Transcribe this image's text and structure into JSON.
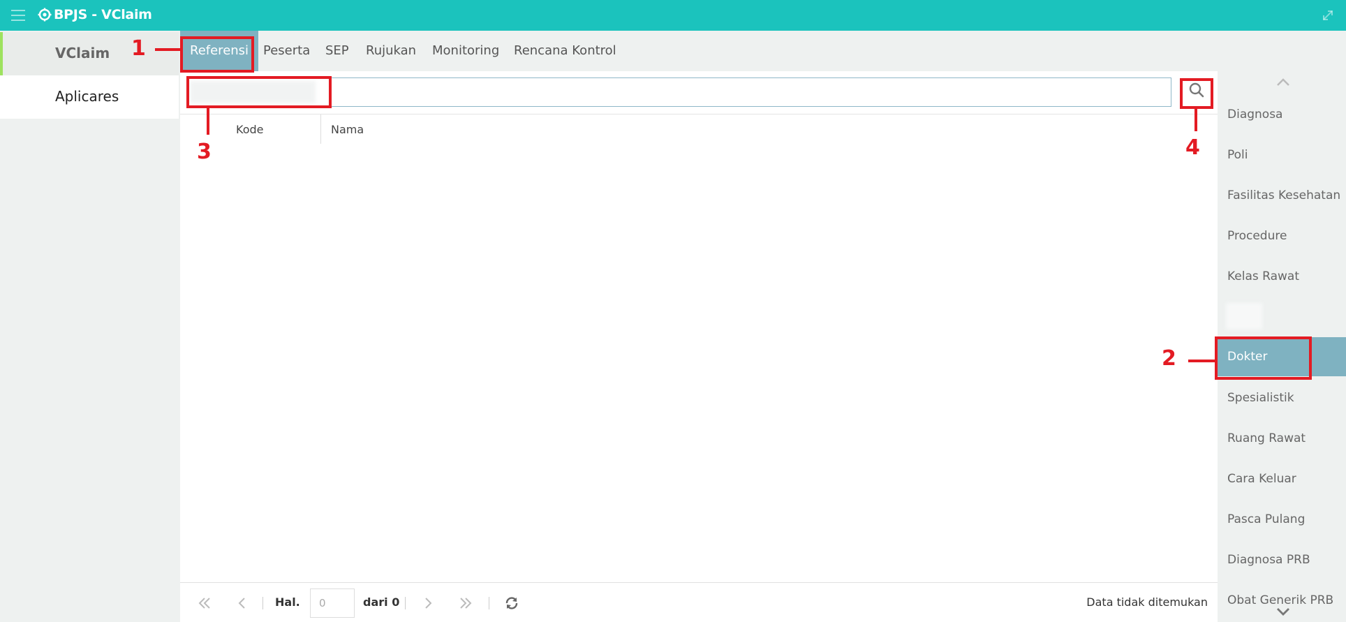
{
  "app": {
    "title": "BPJS - VClaim"
  },
  "sidebar": {
    "items": [
      {
        "label": "VClaim"
      },
      {
        "label": "Aplicares"
      }
    ]
  },
  "tabs": [
    {
      "label": "Referensi",
      "active": true
    },
    {
      "label": "Peserta"
    },
    {
      "label": "SEP"
    },
    {
      "label": "Rujukan"
    },
    {
      "label": "Monitoring"
    },
    {
      "label": "Rencana Kontrol"
    }
  ],
  "search": {
    "value": "",
    "placeholder": ""
  },
  "grid": {
    "columns": [
      "Kode",
      "Nama"
    ]
  },
  "pager": {
    "page_label": "Hal.",
    "page_value": "0",
    "of_label": "dari 0",
    "status": "Data tidak ditemukan"
  },
  "right_menu": {
    "items": [
      {
        "label": "Diagnosa"
      },
      {
        "label": "Poli"
      },
      {
        "label": "Fasilitas Kesehatan"
      },
      {
        "label": "Procedure"
      },
      {
        "label": "Kelas Rawat"
      },
      {
        "label": "Dokter",
        "active": true
      },
      {
        "label": "Spesialistik"
      },
      {
        "label": "Ruang Rawat"
      },
      {
        "label": "Cara Keluar"
      },
      {
        "label": "Pasca Pulang"
      },
      {
        "label": "Diagnosa PRB"
      },
      {
        "label": "Obat Generik PRB"
      }
    ]
  },
  "annotations": [
    "1",
    "2",
    "3",
    "4"
  ],
  "colors": {
    "titlebar": "#1bc3bd",
    "active_tab": "#7fb2c1",
    "annotation": "#e31b23",
    "sidebar_accent": "#9ee25f"
  }
}
